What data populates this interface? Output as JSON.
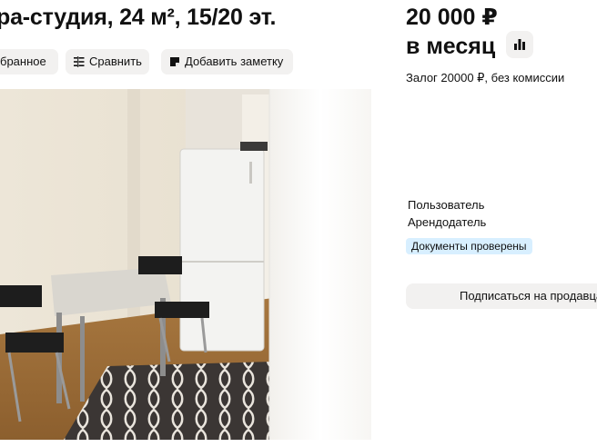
{
  "listing": {
    "title": "ра-студия, 24 м², 15/20 эт.",
    "actions": {
      "favorite_label": "бранное",
      "compare_label": "Сравнить",
      "note_label": "Добавить заметку"
    }
  },
  "pricing": {
    "price": "20 000 ₽",
    "period": "в месяц",
    "deposit": "Залог 20000 ₽, без комиссии"
  },
  "seller": {
    "name": "Пользователь",
    "role": "Арендодатель",
    "badge": "Документы проверены",
    "subscribe_label": "Подписаться на продавца"
  },
  "icons": {
    "compare": "compare-icon",
    "note": "note-icon",
    "stats": "bar-chart-icon"
  },
  "colors": {
    "chip_bg": "#f2f1f0",
    "badge_bg": "#d8efff"
  }
}
